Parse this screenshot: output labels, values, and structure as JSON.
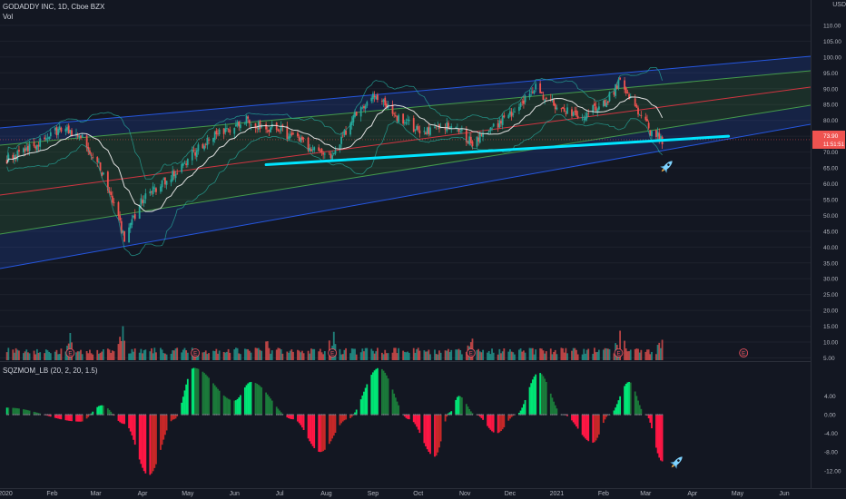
{
  "header": {
    "symbol_title": "GODADDY INC, 1D, Cboe BZX",
    "volume_label": "Vol",
    "currency": "USD"
  },
  "indicator_label": "SQZMOM_LB (20, 2, 20, 1.5)",
  "price_labels": {
    "last_price": "73.90",
    "countdown": "11:51:51"
  },
  "colors": {
    "background": "#131722",
    "up_candle": "#26a69a",
    "down_candle": "#ef5350",
    "support_line": "#00e5ff",
    "channel_blue": "#2962ff",
    "channel_green": "#4caf50",
    "channel_mid": "#f23645",
    "moving_average": "#e0e0e0",
    "bollinger": "#26a69a",
    "sqz_green": "#00c853",
    "sqz_red": "#ff1744",
    "earnings_marker": "#f7525f"
  },
  "icons": [
    "rocket-icon",
    "earnings-icon"
  ],
  "earnings_marker_letter": "E",
  "chart_data": {
    "type": "candlestick",
    "title": "GODADDY INC, 1D, Cboe BZX",
    "x_ticks": [
      "2020",
      "Feb",
      "Mar",
      "Apr",
      "May",
      "Jun",
      "Jul",
      "Aug",
      "Sep",
      "Oct",
      "Nov",
      "Dec",
      "2021",
      "Feb",
      "Mar",
      "Apr",
      "May",
      "Jun"
    ],
    "price_axis": {
      "unit": "USD",
      "ticks": [
        "110.00",
        "105.00",
        "100.00",
        "95.00",
        "90.00",
        "85.00",
        "80.00",
        "75.00",
        "70.00",
        "65.00",
        "60.00",
        "55.00",
        "50.00",
        "45.00",
        "40.00",
        "35.00",
        "30.00",
        "25.00",
        "20.00",
        "15.00",
        "10.00",
        "5.00"
      ],
      "ylim": [
        5,
        113
      ]
    },
    "indicator_axis": {
      "ticks": [
        "4.00",
        "0.00",
        "-4.00",
        "-8.00",
        "-12.00"
      ],
      "ylim": [
        -14,
        11
      ]
    },
    "key_closes": [
      {
        "date": "2020-01-02",
        "close": 68
      },
      {
        "date": "2020-01-20",
        "close": 72
      },
      {
        "date": "2020-02-06",
        "close": 77
      },
      {
        "date": "2020-02-20",
        "close": 75
      },
      {
        "date": "2020-03-03",
        "close": 66
      },
      {
        "date": "2020-03-12",
        "close": 55
      },
      {
        "date": "2020-03-20",
        "close": 42
      },
      {
        "date": "2020-04-01",
        "close": 55
      },
      {
        "date": "2020-04-20",
        "close": 62
      },
      {
        "date": "2020-05-05",
        "close": 70
      },
      {
        "date": "2020-05-22",
        "close": 76
      },
      {
        "date": "2020-06-08",
        "close": 80
      },
      {
        "date": "2020-06-22",
        "close": 78
      },
      {
        "date": "2020-07-01",
        "close": 77
      },
      {
        "date": "2020-07-20",
        "close": 72
      },
      {
        "date": "2020-08-05",
        "close": 68
      },
      {
        "date": "2020-08-20",
        "close": 82
      },
      {
        "date": "2020-09-02",
        "close": 88
      },
      {
        "date": "2020-09-20",
        "close": 80
      },
      {
        "date": "2020-10-05",
        "close": 76
      },
      {
        "date": "2020-10-22",
        "close": 79
      },
      {
        "date": "2020-11-05",
        "close": 73
      },
      {
        "date": "2020-11-20",
        "close": 78
      },
      {
        "date": "2020-12-05",
        "close": 84
      },
      {
        "date": "2020-12-18",
        "close": 90
      },
      {
        "date": "2021-01-05",
        "close": 83
      },
      {
        "date": "2021-01-20",
        "close": 82
      },
      {
        "date": "2021-02-01",
        "close": 85
      },
      {
        "date": "2021-02-12",
        "close": 92
      },
      {
        "date": "2021-02-22",
        "close": 84
      },
      {
        "date": "2021-03-05",
        "close": 76
      },
      {
        "date": "2021-03-12",
        "close": 73.9
      }
    ],
    "support_line": {
      "start": {
        "date": "2020-06-22",
        "price": 66
      },
      "end": {
        "date": "2021-04-25",
        "price": 75
      }
    },
    "earnings_dates": [
      "2020-02-13",
      "2020-05-06",
      "2020-08-05",
      "2020-11-05",
      "2021-02-11",
      "2021-05-05"
    ],
    "volume_peaks": [
      {
        "date": "2020-02-13",
        "value": 24
      },
      {
        "date": "2020-03-19",
        "value": 30
      },
      {
        "date": "2020-06-20",
        "value": 20
      },
      {
        "date": "2020-08-06",
        "value": 25
      },
      {
        "date": "2020-11-06",
        "value": 19
      },
      {
        "date": "2021-02-12",
        "value": 26
      },
      {
        "date": "2021-03-12",
        "value": 18
      }
    ],
    "momentum_keypoints": [
      {
        "date": "2020-01-02",
        "value": 1.5
      },
      {
        "date": "2020-02-20",
        "value": -1.5
      },
      {
        "date": "2020-03-05",
        "value": 2
      },
      {
        "date": "2020-03-20",
        "value": -2
      },
      {
        "date": "2020-04-05",
        "value": -13
      },
      {
        "date": "2020-04-22",
        "value": -1
      },
      {
        "date": "2020-05-05",
        "value": 10
      },
      {
        "date": "2020-06-01",
        "value": 3
      },
      {
        "date": "2020-06-12",
        "value": 7
      },
      {
        "date": "2020-07-10",
        "value": -1
      },
      {
        "date": "2020-07-28",
        "value": -8
      },
      {
        "date": "2020-08-15",
        "value": -1
      },
      {
        "date": "2020-09-05",
        "value": 10
      },
      {
        "date": "2020-09-25",
        "value": -1
      },
      {
        "date": "2020-10-12",
        "value": -9
      },
      {
        "date": "2020-10-22",
        "value": 0.5
      },
      {
        "date": "2020-10-28",
        "value": 4
      },
      {
        "date": "2020-11-08",
        "value": 0
      },
      {
        "date": "2020-11-22",
        "value": -4
      },
      {
        "date": "2020-12-05",
        "value": 0
      },
      {
        "date": "2020-12-20",
        "value": 9
      },
      {
        "date": "2021-01-05",
        "value": 0
      },
      {
        "date": "2021-01-25",
        "value": -6
      },
      {
        "date": "2021-02-05",
        "value": 0
      },
      {
        "date": "2021-02-18",
        "value": 7
      },
      {
        "date": "2021-03-01",
        "value": 0
      },
      {
        "date": "2021-03-12",
        "value": -10
      }
    ]
  }
}
